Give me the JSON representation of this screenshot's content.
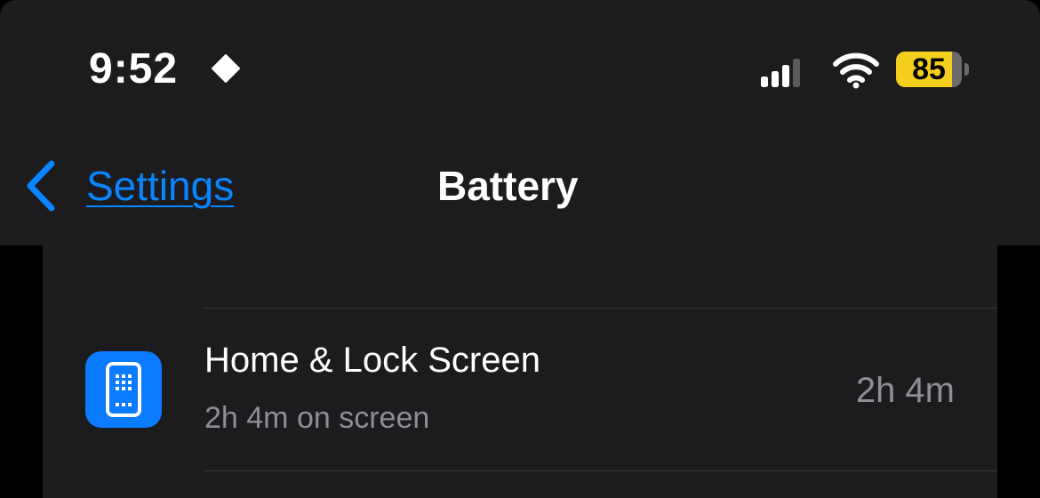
{
  "status_bar": {
    "time": "9:52",
    "location_icon": "diamond-icon",
    "signal_icon": "cellular-signal-icon",
    "wifi_icon": "wifi-icon",
    "battery_level": "85",
    "battery_fill_fraction": 0.85,
    "battery_color": "#f5cf1e"
  },
  "nav": {
    "back_label": "Settings",
    "back_icon": "chevron-left-icon",
    "title": "Battery",
    "accent_color": "#0a84ff"
  },
  "list": {
    "items": [
      {
        "title": "Home & Lock Screen",
        "subtitle": "2h 4m on screen",
        "value": "2h 4m",
        "icon": "home-lock-screen-icon",
        "icon_color": "#0a7aff"
      }
    ]
  }
}
